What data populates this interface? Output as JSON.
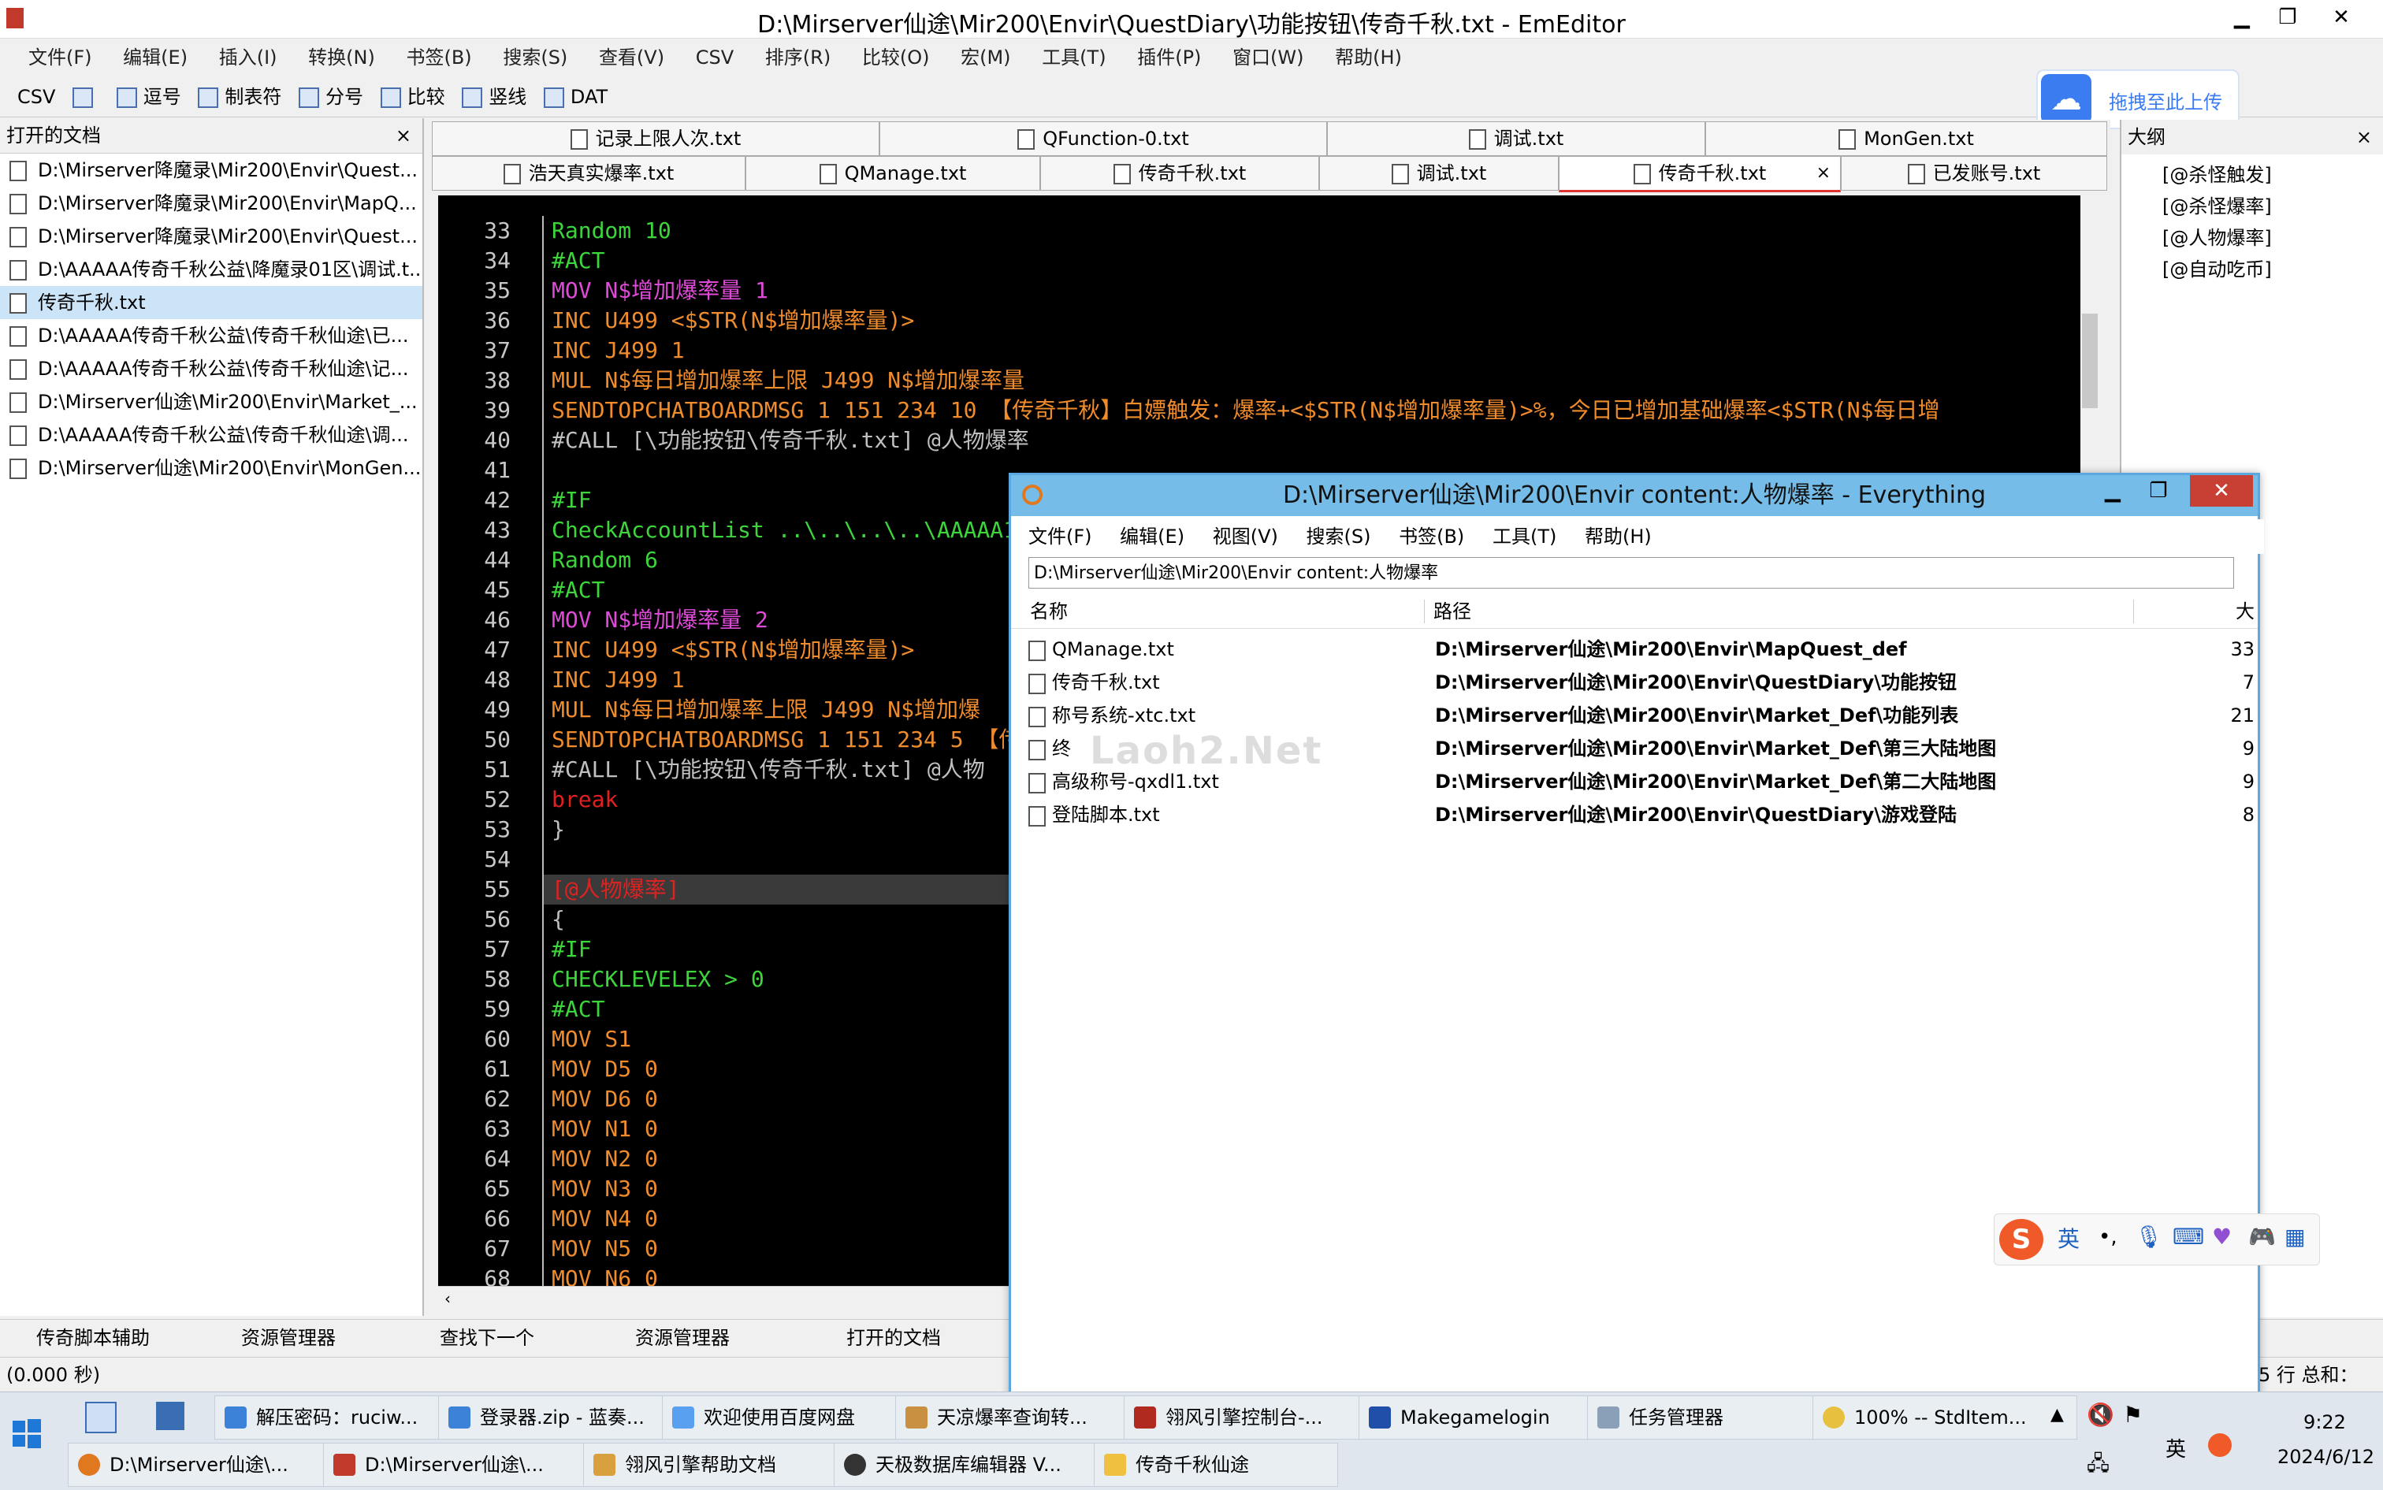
{
  "window": {
    "title": "D:\\Mirserver仙途\\Mir200\\Envir\\QuestDiary\\功能按钮\\传奇千秋.txt - EmEditor"
  },
  "menu": [
    "文件(F)",
    "编辑(E)",
    "插入(I)",
    "转换(N)",
    "书签(B)",
    "搜索(S)",
    "查看(V)",
    "CSV",
    "排序(R)",
    "比较(O)",
    "宏(M)",
    "工具(T)",
    "插件(P)",
    "窗口(W)",
    "帮助(H)"
  ],
  "toolbar": {
    "csv": "CSV",
    "items": [
      "逗号",
      "制表符",
      "分号",
      "比较",
      "竖线",
      "DAT"
    ]
  },
  "upload": {
    "label": "拖拽至此上传"
  },
  "left_panel": {
    "title": "打开的文档",
    "close": "×",
    "docs": [
      "D:\\Mirserver降魔录\\Mir200\\Envir\\Quest...",
      "D:\\Mirserver降魔录\\Mir200\\Envir\\MapQ...",
      "D:\\Mirserver降魔录\\Mir200\\Envir\\Quest...",
      "D:\\AAAAA传奇千秋公益\\降魔录01区\\调试.t...",
      "传奇千秋.txt",
      "D:\\AAAAA传奇千秋公益\\传奇千秋仙途\\已...",
      "D:\\AAAAA传奇千秋公益\\传奇千秋仙途\\记...",
      "D:\\Mirserver仙途\\Mir200\\Envir\\Market_...",
      "D:\\AAAAA传奇千秋公益\\传奇千秋仙途\\调...",
      "D:\\Mirserver仙途\\Mir200\\Envir\\MonGen..."
    ]
  },
  "tabs": {
    "row1": [
      "记录上限人次.txt",
      "QFunction-0.txt",
      "调试.txt",
      "MonGen.txt"
    ],
    "row2": [
      "浩天真实爆率.txt",
      "QManage.txt",
      "传奇千秋.txt",
      "调试.txt",
      "传奇千秋.txt",
      "已发账号.txt"
    ],
    "close": "×"
  },
  "editor": {
    "line_numbers": [
      "33",
      "34",
      "35",
      "36",
      "37",
      "38",
      "39",
      "40",
      "41",
      "42",
      "43",
      "44",
      "45",
      "46",
      "47",
      "48",
      "49",
      "50",
      "51",
      "52",
      "53",
      "54",
      "55",
      "56",
      "57",
      "58",
      "59",
      "60",
      "61",
      "62",
      "63",
      "64",
      "65",
      "66",
      "67",
      "68"
    ],
    "lines": [
      "Random 10",
      "#ACT",
      "MOV N$增加爆率量 1",
      "INC U499 <$STR(N$增加爆率量)>",
      "INC J499 1",
      "MUL N$每日增加爆率上限 J499 N$增加爆率量",
      "SENDTOPCHATBOARDMSG 1 151 234 10 【传奇千秋】白嫖触发：爆率+<$STR(N$增加爆率量)>%，今日已增加基础爆率<$STR(N$每日增",
      "#CALL [\\功能按钮\\传奇千秋.txt] @人物爆率",
      "",
      "#IF",
      "CheckAccountList ..\\..\\..\\..\\AAAAA1",
      "Random 6",
      "#ACT",
      "MOV N$增加爆率量 2",
      "INC U499 <$STR(N$增加爆率量)>",
      "INC J499 1",
      "MUL N$每日增加爆率上限 J499 N$增加爆",
      "SENDTOPCHATBOARDMSG 1 151 234 5 【传",
      "#CALL [\\功能按钮\\传奇千秋.txt] @人物",
      "break",
      "}",
      "",
      "[@人物爆率]",
      "{",
      "#IF",
      "CHECKLEVELEX > 0",
      "#ACT",
      "MOV S1",
      "MOV D5 0",
      "MOV D6 0",
      "MOV N1 0",
      "MOV N2 0",
      "MOV N3 0",
      "MOV N4 0",
      "MOV N5 0",
      "MOV N6 0"
    ]
  },
  "outline": {
    "title": "大纲",
    "close": "×",
    "items": [
      "[@杀怪触发]",
      "[@杀怪爆率]",
      "[@人物爆率]",
      "[@自动吃币]"
    ]
  },
  "bottom_tabs": [
    "传奇脚本辅助",
    "资源管理器",
    "查找下一个",
    "资源管理器",
    "打开的文档"
  ],
  "status": {
    "left": "(0.000 秒)",
    "right": "5 行 总和："
  },
  "everything": {
    "title": "D:\\Mirserver仙途\\Mir200\\Envir content:人物爆率 - Everything",
    "menu": [
      "文件(F)",
      "编辑(E)",
      "视图(V)",
      "搜索(S)",
      "书签(B)",
      "工具(T)",
      "帮助(H)"
    ],
    "search": "D:\\Mirserver仙途\\Mir200\\Envir content:人物爆率",
    "columns": [
      "名称",
      "路径",
      "大"
    ],
    "rows": [
      {
        "name": "QManage.txt",
        "path": "D:\\Mirserver仙途\\Mir200\\Envir\\MapQuest_def",
        "size": "33"
      },
      {
        "name": "传奇千秋.txt",
        "path": "D:\\Mirserver仙途\\Mir200\\Envir\\QuestDiary\\功能按钮",
        "size": "7"
      },
      {
        "name": "称号系统-xtc.txt",
        "path": "D:\\Mirserver仙途\\Mir200\\Envir\\Market_Def\\功能列表",
        "size": "21"
      },
      {
        "name": "终",
        "path": "D:\\Mirserver仙途\\Mir200\\Envir\\Market_Def\\第三大陆地图",
        "size": "9"
      },
      {
        "name": "高级称号-qxdl1.txt",
        "path": "D:\\Mirserver仙途\\Mir200\\Envir\\Market_Def\\第二大陆地图",
        "size": "9"
      },
      {
        "name": "登陆脚本.txt",
        "path": "D:\\Mirserver仙途\\Mir200\\Envir\\QuestDiary\\游戏登陆",
        "size": "8"
      }
    ],
    "watermark": "Laoh2.Net"
  },
  "ime": {
    "lang": "英"
  },
  "taskbar": {
    "row1": [
      "解压密码：ruciw...",
      "登录器.zip - 蓝奏...",
      "欢迎使用百度网盘",
      "天凉爆率查询转...",
      "翎风引擎控制台-...",
      "Makegamelogin",
      "任务管理器",
      "100% -- StdItem..."
    ],
    "row2": [
      "D:\\Mirserver仙途\\...",
      "D:\\Mirserver仙途\\...",
      "翎风引擎帮助文档",
      "天极数据库编辑器 V...",
      "传奇千秋仙途"
    ],
    "time": "9:22",
    "date": "2024/6/12",
    "tray_lang": "英"
  },
  "colors": {
    "accent": "#75bde8",
    "comment": "#c0c0c0",
    "keyword_green": "#3cd63c",
    "string_magenta": "#e04ad8",
    "cmd_orange": "#f08c2c",
    "red": "#e02020"
  }
}
